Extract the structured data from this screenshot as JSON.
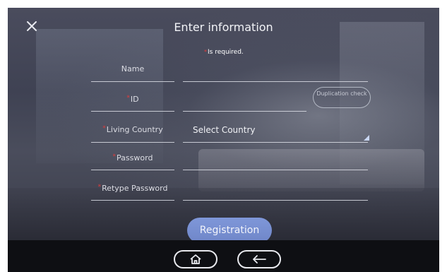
{
  "header": {
    "title": "Enter information",
    "required_note": "Is required."
  },
  "form": {
    "name_label": "Name",
    "id_label": "ID",
    "duplication_check_label": "Duplication check",
    "country_label": "Living Country",
    "country_value": "Select Country",
    "password_label": "Password",
    "retype_password_label": "Retype Password",
    "required_marker": "*"
  },
  "actions": {
    "register_label": "Registration"
  },
  "nav": {
    "home_icon": "home-icon",
    "back_icon": "back-arrow-icon"
  },
  "colors": {
    "accent": "#7a91d4",
    "required": "#e23b3b"
  }
}
